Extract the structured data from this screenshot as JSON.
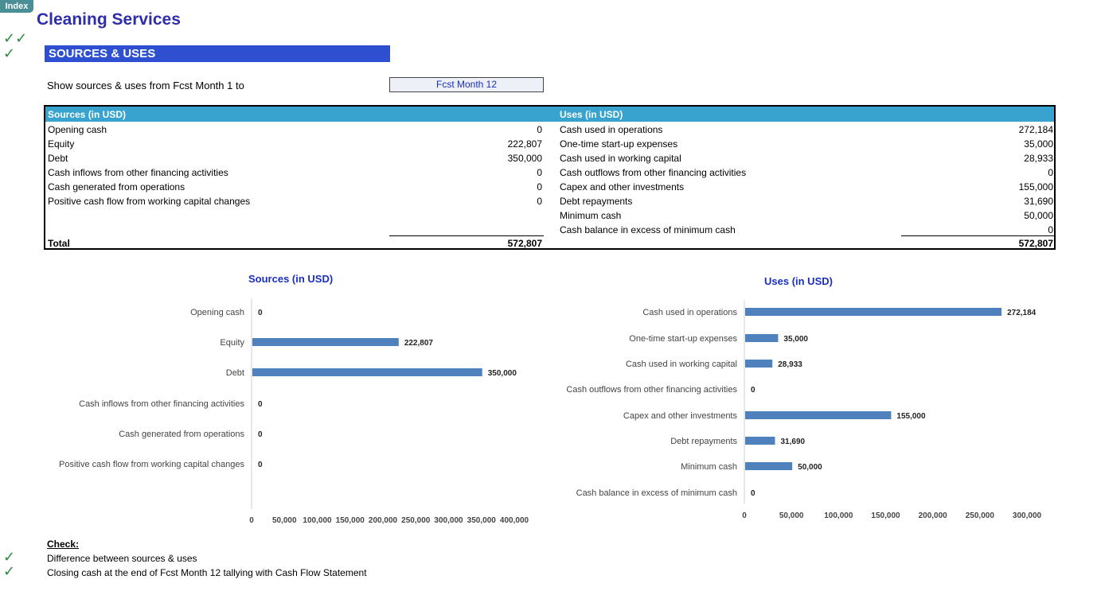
{
  "nav": {
    "index_label": "Index"
  },
  "header": {
    "title": "Cleaning Services",
    "checks_top": [
      "✓✓",
      "✓"
    ],
    "section_title": "SOURCES & USES"
  },
  "controls": {
    "show_label": "Show sources & uses from Fcst Month 1 to",
    "selected_month": "Fcst Month 12"
  },
  "table": {
    "sources_header": "Sources (in USD)",
    "uses_header": "Uses (in USD)",
    "sources": [
      {
        "label": "Opening cash",
        "value": "0"
      },
      {
        "label": "Equity",
        "value": "222,807"
      },
      {
        "label": "Debt",
        "value": "350,000"
      },
      {
        "label": "Cash inflows from other financing activities",
        "value": "0"
      },
      {
        "label": "Cash generated from operations",
        "value": "0"
      },
      {
        "label": "Positive cash flow from working capital changes",
        "value": "0"
      }
    ],
    "uses": [
      {
        "label": "Cash used in operations",
        "value": "272,184"
      },
      {
        "label": "One-time start-up expenses",
        "value": "35,000"
      },
      {
        "label": "Cash used in working capital",
        "value": "28,933"
      },
      {
        "label": "Cash outflows from other  financing activities",
        "value": "0"
      },
      {
        "label": "Capex and other investments",
        "value": "155,000"
      },
      {
        "label": "Debt repayments",
        "value": "31,690"
      },
      {
        "label": "Minimum cash",
        "value": "50,000"
      },
      {
        "label": "Cash balance in excess of minimum cash",
        "value": "0"
      }
    ],
    "total_label": "Total",
    "sources_total": "572,807",
    "uses_total": "572,807"
  },
  "chart_data": [
    {
      "type": "bar",
      "orientation": "horizontal",
      "title": "Sources (in USD)",
      "categories": [
        "Opening cash",
        "Equity",
        "Debt",
        "Cash inflows from other financing activities",
        "Cash generated from operations",
        "Positive cash flow from working capital changes"
      ],
      "values": [
        0,
        222807,
        350000,
        0,
        0,
        0
      ],
      "value_labels": [
        "0",
        "222,807",
        "350,000",
        "0",
        "0",
        "0"
      ],
      "xlim": [
        0,
        400000
      ],
      "ticks": [
        "0",
        "50,000",
        "100,000",
        "150,000",
        "200,000",
        "250,000",
        "300,000",
        "350,000",
        "400,000"
      ],
      "color": "#4f81bd"
    },
    {
      "type": "bar",
      "orientation": "horizontal",
      "title": "Uses (in USD)",
      "categories": [
        "Cash used in operations",
        "One-time start-up expenses",
        "Cash used in working capital",
        "Cash outflows from other  financing activities",
        "Capex and other investments",
        "Debt repayments",
        "Minimum cash",
        "Cash balance in excess of minimum cash"
      ],
      "values": [
        272184,
        35000,
        28933,
        0,
        155000,
        31690,
        50000,
        0
      ],
      "value_labels": [
        "272,184",
        "35,000",
        "28,933",
        "0",
        "155,000",
        "31,690",
        "50,000",
        "0"
      ],
      "xlim": [
        0,
        300000
      ],
      "ticks": [
        "0",
        "50,000",
        "100,000",
        "150,000",
        "200,000",
        "250,000",
        "300,000"
      ],
      "color": "#4f81bd"
    }
  ],
  "checks": {
    "heading": "Check:",
    "items": [
      {
        "mark": "✓",
        "label": "Difference between sources & uses"
      },
      {
        "mark": "✓",
        "label": "Closing cash at the end of Fcst Month 12 tallying with Cash Flow Statement"
      }
    ]
  }
}
